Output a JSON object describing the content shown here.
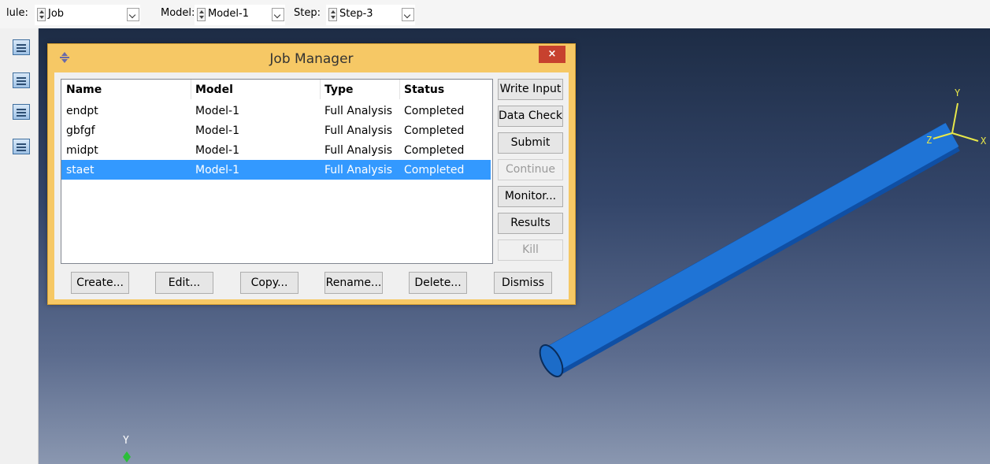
{
  "toolbar": {
    "module_label": "lule:",
    "module_value": "Job",
    "model_label": "Model:",
    "model_value": "Model-1",
    "step_label": "Step:",
    "step_value": "Step-3"
  },
  "left_toolbox": {
    "icons": [
      "job-manager-icon",
      "adaptivity-manager-icon",
      "co-execution-manager-icon",
      "optimization-manager-icon"
    ]
  },
  "job_manager": {
    "title": "Job Manager",
    "close_label": "×",
    "columns": [
      "Name",
      "Model",
      "Type",
      "Status"
    ],
    "rows": [
      {
        "name": "endpt",
        "model": "Model-1",
        "type": "Full Analysis",
        "status": "Completed"
      },
      {
        "name": "gbfgf",
        "model": "Model-1",
        "type": "Full Analysis",
        "status": "Completed"
      },
      {
        "name": "midpt",
        "model": "Model-1",
        "type": "Full Analysis",
        "status": "Completed"
      },
      {
        "name": "staet",
        "model": "Model-1",
        "type": "Full Analysis",
        "status": "Completed"
      }
    ],
    "selected_row": 3,
    "side_buttons": [
      "Write Input",
      "Data Check",
      "Submit",
      "Continue",
      "Monitor...",
      "Results",
      "Kill"
    ],
    "bottom_buttons": [
      "Create...",
      "Edit...",
      "Copy...",
      "Rename...",
      "Delete...",
      "Dismiss"
    ]
  },
  "viewport": {
    "triad_top": {
      "y": "Y",
      "x": "X",
      "z": "Z"
    },
    "triad_bottom": {
      "y": "Y"
    },
    "colors": {
      "part": "#1f74d6",
      "background_top": "#1d2c45",
      "background_bottom": "#8a97b0",
      "triad": "#e8e84a"
    }
  }
}
